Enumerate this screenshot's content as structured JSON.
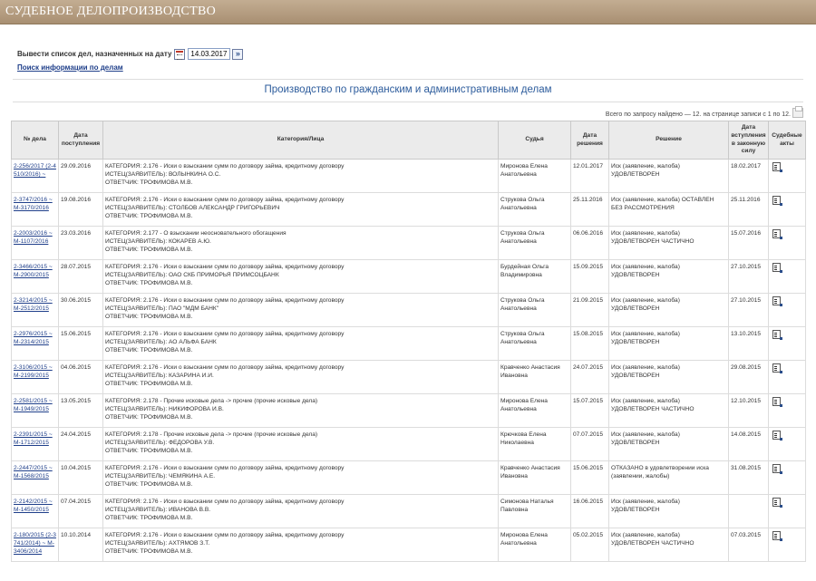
{
  "header": {
    "title": "СУДЕБНОЕ ДЕЛОПРОИЗВОДСТВО"
  },
  "filter": {
    "label": "Вывести список дел, назначенных на дату",
    "date_value": "14.03.2017",
    "go_symbol": "»",
    "search_link": "Поиск информации по делам"
  },
  "heading": "Производство по гражданским и административным делам",
  "summary": "Всего по запросу найдено — 12. на странице записи с 1 по 12.",
  "columns": {
    "case_no": "№ дела",
    "received": "Дата поступления",
    "category": "Категория/Лица",
    "judge": "Судья",
    "decision_date": "Дата решения",
    "decision": "Решение",
    "effective_date": "Дата вступления в законную силу",
    "acts": "Судебные акты"
  },
  "rows": [
    {
      "case_no": "2-256/2017 (2-4510/2016) ~",
      "received": "29.09.2016",
      "cat": "КАТЕГОРИЯ: 2.176 - Иски о взыскании сумм по договору займа, кредитному договору",
      "plaintiff": "ИСТЕЦ(ЗАЯВИТЕЛЬ): ВОЛЫНКИНА О.С.",
      "defendant": "ОТВЕТЧИК: ТРОФИМОВА М.В.",
      "judge": "Миронова Елена Анатольевна",
      "decision_date": "12.01.2017",
      "decision": "Иск (заявление, жалоба) УДОВЛЕТВОРЕН",
      "effective": "18.02.2017"
    },
    {
      "case_no": "2-3747/2016 ~ М-3170/2016",
      "received": "19.08.2016",
      "cat": "КАТЕГОРИЯ: 2.176 - Иски о взыскании сумм по договору займа, кредитному договору",
      "plaintiff": "ИСТЕЦ(ЗАЯВИТЕЛЬ): СТОЛБОВ АЛЕКСАНДР ГРИГОРЬЕВИЧ",
      "defendant": "ОТВЕТЧИК: ТРОФИМОВА М.В.",
      "judge": "Струкова Ольга Анатольевна",
      "decision_date": "25.11.2016",
      "decision": "Иск (заявление, жалоба) ОСТАВЛЕН БЕЗ РАССМОТРЕНИЯ",
      "effective": "25.11.2016"
    },
    {
      "case_no": "2-2003/2016 ~ М-1107/2016",
      "received": "23.03.2016",
      "cat": "КАТЕГОРИЯ: 2.177 - О взыскании неосновательного обогащения",
      "plaintiff": "ИСТЕЦ(ЗАЯВИТЕЛЬ): КОКАРЕВ А.Ю.",
      "defendant": "ОТВЕТЧИК: ТРОФИМОВА М.В.",
      "judge": "Струкова Ольга Анатольевна",
      "decision_date": "06.06.2016",
      "decision": "Иск (заявление, жалоба) УДОВЛЕТВОРЕН ЧАСТИЧНО",
      "effective": "15.07.2016"
    },
    {
      "case_no": "2-3466/2015 ~ М-2900/2015",
      "received": "28.07.2015",
      "cat": "КАТЕГОРИЯ: 2.176 - Иски о взыскании сумм по договору займа, кредитному договору",
      "plaintiff": "ИСТЕЦ(ЗАЯВИТЕЛЬ): ОАО СКБ ПРИМОРЬЯ ПРИМСОЦБАНК",
      "defendant": "ОТВЕТЧИК: ТРОФИМОВА М.В.",
      "judge": "Бурдейная Ольга Владимировна",
      "decision_date": "15.09.2015",
      "decision": "Иск (заявление, жалоба) УДОВЛЕТВОРЕН",
      "effective": "27.10.2015"
    },
    {
      "case_no": "2-3214/2015 ~ М-2512/2015",
      "received": "30.06.2015",
      "cat": "КАТЕГОРИЯ: 2.176 - Иски о взыскании сумм по договору займа, кредитному договору",
      "plaintiff": "ИСТЕЦ(ЗАЯВИТЕЛЬ): ПАО \"МДМ БАНК\"",
      "defendant": "ОТВЕТЧИК: ТРОФИМОВА М.В.",
      "judge": "Струкова Ольга Анатольевна",
      "decision_date": "21.09.2015",
      "decision": "Иск (заявление, жалоба) УДОВЛЕТВОРЕН",
      "effective": "27.10.2015"
    },
    {
      "case_no": "2-2976/2015 ~ М-2314/2015",
      "received": "15.06.2015",
      "cat": "КАТЕГОРИЯ: 2.176 - Иски о взыскании сумм по договору займа, кредитному договору",
      "plaintiff": "ИСТЕЦ(ЗАЯВИТЕЛЬ): АО АЛЬФА БАНК",
      "defendant": "ОТВЕТЧИК: ТРОФИМОВА М.В.",
      "judge": "Струкова Ольга Анатольевна",
      "decision_date": "15.08.2015",
      "decision": "Иск (заявление, жалоба) УДОВЛЕТВОРЕН",
      "effective": "13.10.2015"
    },
    {
      "case_no": "2-3106/2015 ~ М-2199/2015",
      "received": "04.06.2015",
      "cat": "КАТЕГОРИЯ: 2.176 - Иски о взыскании сумм по договору займа, кредитному договору",
      "plaintiff": "ИСТЕЦ(ЗАЯВИТЕЛЬ): КАЗАРИНА И.И.",
      "defendant": "ОТВЕТЧИК: ТРОФИМОВА М.В.",
      "judge": "Кравченко Анастасия Ивановна",
      "decision_date": "24.07.2015",
      "decision": "Иск (заявление, жалоба) УДОВЛЕТВОРЕН",
      "effective": "29.08.2015"
    },
    {
      "case_no": "2-2581/2015 ~ М-1949/2015",
      "received": "13.05.2015",
      "cat": "КАТЕГОРИЯ: 2.178 - Прочие исковые дела -> прочие (прочие исковые дела)",
      "plaintiff": "ИСТЕЦ(ЗАЯВИТЕЛЬ): НИКИФОРОВА И.В.",
      "defendant": "ОТВЕТЧИК: ТРОФИМОВА М.В.",
      "judge": "Миронова Елена Анатольевна",
      "decision_date": "15.07.2015",
      "decision": "Иск (заявление, жалоба) УДОВЛЕТВОРЕН ЧАСТИЧНО",
      "effective": "12.10.2015"
    },
    {
      "case_no": "2-2391/2015 ~ М-1712/2015",
      "received": "24.04.2015",
      "cat": "КАТЕГОРИЯ: 2.178 - Прочие исковые дела -> прочие (прочие исковые дела)",
      "plaintiff": "ИСТЕЦ(ЗАЯВИТЕЛЬ): ФЕДОРОВА У.В.",
      "defendant": "ОТВЕТЧИК: ТРОФИМОВА М.В.",
      "judge": "Крючкова Елена Николаевна",
      "decision_date": "07.07.2015",
      "decision": "Иск (заявление, жалоба) УДОВЛЕТВОРЕН",
      "effective": "14.08.2015"
    },
    {
      "case_no": "2-2447/2015 ~ М-1568/2015",
      "received": "10.04.2015",
      "cat": "КАТЕГОРИЯ: 2.176 - Иски о взыскании сумм по договору займа, кредитному договору",
      "plaintiff": "ИСТЕЦ(ЗАЯВИТЕЛЬ): ЧЕМЯКИНА А.Е.",
      "defendant": "ОТВЕТЧИК: ТРОФИМОВА М.В.",
      "judge": "Кравченко Анастасия Ивановна",
      "decision_date": "15.06.2015",
      "decision": "ОТКАЗАНО в удовлетворении иска (заявлении, жалобы)",
      "effective": "31.08.2015"
    },
    {
      "case_no": "2-2142/2015 ~ М-1450/2015",
      "received": "07.04.2015",
      "cat": "КАТЕГОРИЯ: 2.176 - Иски о взыскании сумм по договору займа, кредитному договору",
      "plaintiff": "ИСТЕЦ(ЗАЯВИТЕЛЬ): ИВАНОВА В.В.",
      "defendant": "ОТВЕТЧИК: ТРОФИМОВА М.В.",
      "judge": "Симонова Наталья Павловна",
      "decision_date": "16.06.2015",
      "decision": "Иск (заявление, жалоба) УДОВЛЕТВОРЕН",
      "effective": ""
    },
    {
      "case_no": "2-180/2015 (2-3741/2014) ~ М-3406/2014",
      "received": "10.10.2014",
      "cat": "КАТЕГОРИЯ: 2.176 - Иски о взыскании сумм по договору займа, кредитному договору",
      "plaintiff": "ИСТЕЦ(ЗАЯВИТЕЛЬ): АХТЯМОВ З.Т.",
      "defendant": "ОТВЕТЧИК: ТРОФИМОВА М.В.",
      "judge": "Миронова Елена Анатольевна",
      "decision_date": "05.02.2015",
      "decision": "Иск (заявление, жалоба) УДОВЛЕТВОРЕН ЧАСТИЧНО",
      "effective": "07.03.2015"
    }
  ]
}
